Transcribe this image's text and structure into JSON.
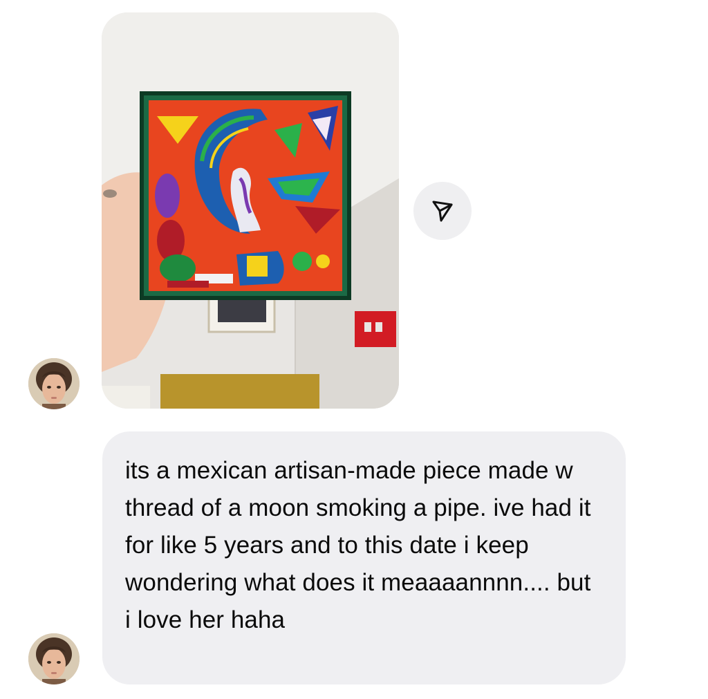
{
  "conversation": {
    "messages": [
      {
        "type": "image",
        "sender_avatar_icon": "user-avatar",
        "image_subject": "embroidered-moon-pipe-artwork"
      },
      {
        "type": "text",
        "sender_avatar_icon": "user-avatar",
        "text": "its a mexican artisan-made piece made w thread of a moon smoking a pipe. ive had it for like 5 years and to this date i keep wondering what does it meaaaannnn.... but i love her haha"
      }
    ],
    "actions": {
      "share_icon": "paper-plane-icon"
    }
  },
  "colors": {
    "bubble_background": "#efeff2",
    "share_button_background": "#efeff1",
    "text": "#0a0a0a"
  }
}
